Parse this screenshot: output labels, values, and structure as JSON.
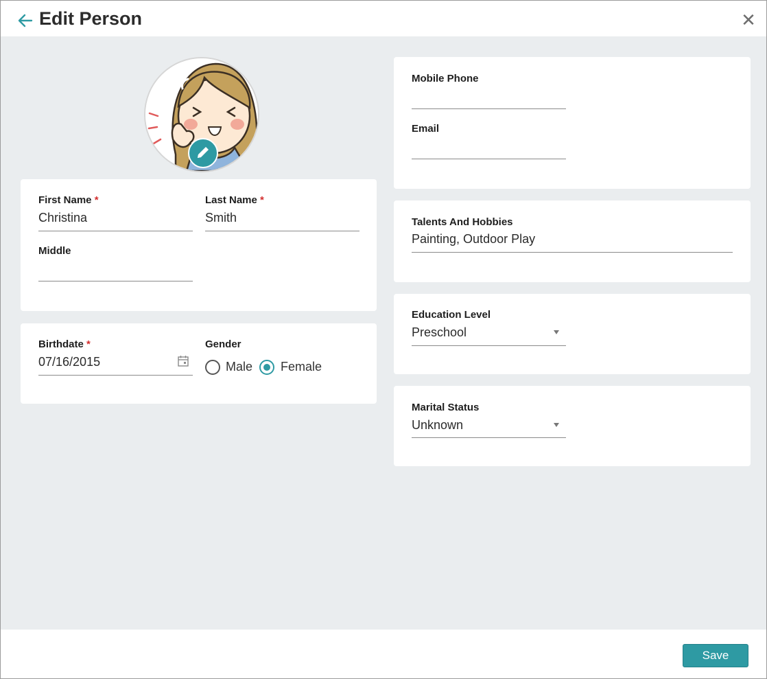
{
  "header": {
    "title": "Edit Person"
  },
  "avatar": {
    "alt": "profile-photo"
  },
  "name_card": {
    "first_name_label": "First Name",
    "first_name_value": "Christina",
    "last_name_label": "Last Name",
    "last_name_value": "Smith",
    "middle_label": "Middle",
    "middle_value": "",
    "required_mark": "*"
  },
  "birth_card": {
    "birthdate_label": "Birthdate",
    "birthdate_value": "07/16/2015",
    "gender_label": "Gender",
    "gender_options": [
      "Male",
      "Female"
    ],
    "gender_selected": "Female"
  },
  "contact_card": {
    "mobile_label": "Mobile Phone",
    "mobile_value": "",
    "email_label": "Email",
    "email_value": ""
  },
  "talents_card": {
    "label": "Talents And Hobbies",
    "value": "Painting, Outdoor Play"
  },
  "education_card": {
    "label": "Education Level",
    "value": "Preschool"
  },
  "marital_card": {
    "label": "Marital Status",
    "value": "Unknown"
  },
  "footer": {
    "save_label": "Save"
  },
  "colors": {
    "accent": "#2e9aa3",
    "required": "#d32f2f",
    "background": "#eaedef"
  }
}
